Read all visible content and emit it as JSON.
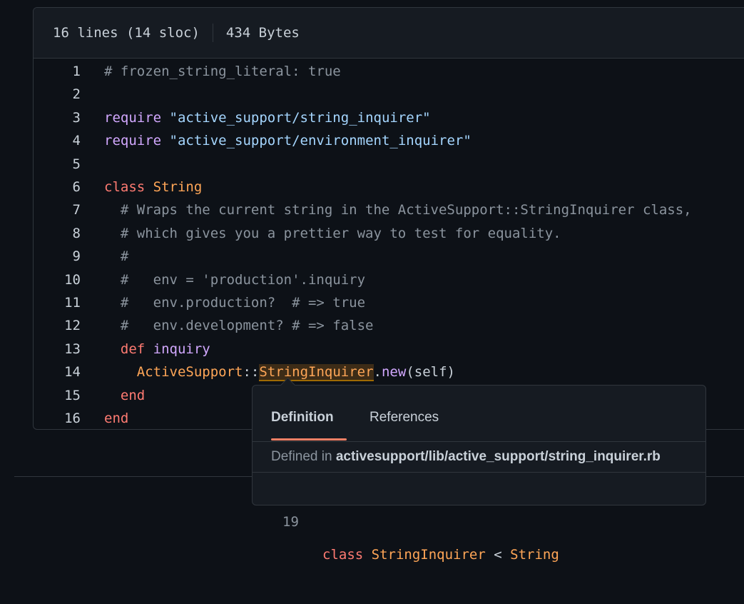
{
  "file_info": {
    "lines": "16 lines (14 sloc)",
    "size": "434 Bytes"
  },
  "code": {
    "lines": [
      {
        "n": "1",
        "tokens": [
          {
            "t": "# frozen_string_literal: true",
            "c": "cm"
          }
        ]
      },
      {
        "n": "2",
        "tokens": []
      },
      {
        "n": "3",
        "tokens": [
          {
            "t": "require",
            "c": "fn"
          },
          {
            "t": " ",
            "c": ""
          },
          {
            "t": "\"active_support/string_inquirer\"",
            "c": "str"
          }
        ]
      },
      {
        "n": "4",
        "tokens": [
          {
            "t": "require",
            "c": "fn"
          },
          {
            "t": " ",
            "c": ""
          },
          {
            "t": "\"active_support/environment_inquirer\"",
            "c": "str"
          }
        ]
      },
      {
        "n": "5",
        "tokens": []
      },
      {
        "n": "6",
        "tokens": [
          {
            "t": "class",
            "c": "kw"
          },
          {
            "t": " ",
            "c": ""
          },
          {
            "t": "String",
            "c": "cls"
          }
        ]
      },
      {
        "n": "7",
        "tokens": [
          {
            "t": "  # Wraps the current string in the ActiveSupport::StringInquirer class,",
            "c": "cm"
          }
        ]
      },
      {
        "n": "8",
        "tokens": [
          {
            "t": "  # which gives you a prettier way to test for equality.",
            "c": "cm"
          }
        ]
      },
      {
        "n": "9",
        "tokens": [
          {
            "t": "  #",
            "c": "cm"
          }
        ]
      },
      {
        "n": "10",
        "tokens": [
          {
            "t": "  #   env = 'production'.inquiry",
            "c": "cm"
          }
        ]
      },
      {
        "n": "11",
        "tokens": [
          {
            "t": "  #   env.production?  # => true",
            "c": "cm"
          }
        ]
      },
      {
        "n": "12",
        "tokens": [
          {
            "t": "  #   env.development? # => false",
            "c": "cm"
          }
        ]
      },
      {
        "n": "13",
        "tokens": [
          {
            "t": "  ",
            "c": ""
          },
          {
            "t": "def",
            "c": "kw"
          },
          {
            "t": " ",
            "c": ""
          },
          {
            "t": "inquiry",
            "c": "fn"
          }
        ]
      },
      {
        "n": "14",
        "tokens": [
          {
            "t": "    ",
            "c": ""
          },
          {
            "t": "ActiveSupport",
            "c": "cls"
          },
          {
            "t": "::",
            "c": ""
          },
          {
            "t": "StringInquirer",
            "c": "cls hl"
          },
          {
            "t": ".",
            "c": ""
          },
          {
            "t": "new",
            "c": "fn"
          },
          {
            "t": "(self)",
            "c": ""
          }
        ]
      },
      {
        "n": "15",
        "tokens": [
          {
            "t": "  ",
            "c": ""
          },
          {
            "t": "end",
            "c": "kw"
          }
        ]
      },
      {
        "n": "16",
        "tokens": [
          {
            "t": "end",
            "c": "kw"
          }
        ]
      }
    ]
  },
  "popover": {
    "tab_definition": "Definition",
    "tab_references": "References",
    "defined_in_label": "Defined in ",
    "defined_in_path": "activesupport/lib/active_support/string_inquirer.rb",
    "def_line_number": "19",
    "def_tokens": [
      {
        "t": "class",
        "c": "kw"
      },
      {
        "t": " ",
        "c": ""
      },
      {
        "t": "StringInquirer",
        "c": "cls"
      },
      {
        "t": " < ",
        "c": ""
      },
      {
        "t": "String",
        "c": "cls"
      }
    ]
  }
}
